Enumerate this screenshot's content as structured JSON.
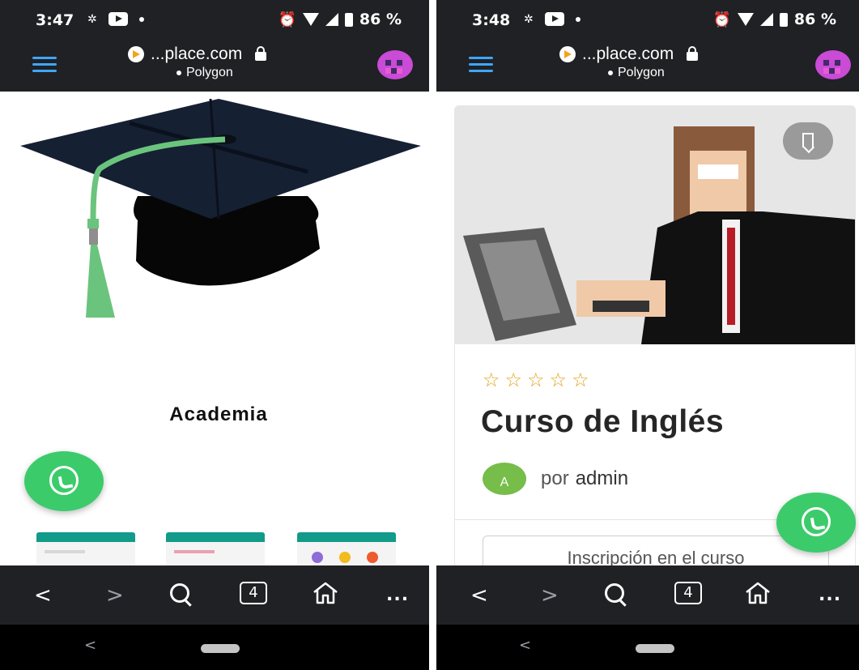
{
  "left": {
    "status": {
      "time": "3:47",
      "battery": "86 %"
    },
    "address": {
      "host": "...place.com",
      "network": "Polygon"
    },
    "page": {
      "title": "Academia"
    },
    "toolbar": {
      "back": "<",
      "forward": ">",
      "tab_count": "4",
      "more": "..."
    },
    "system": {
      "back": "<"
    }
  },
  "right": {
    "status": {
      "time": "3:48",
      "battery": "86 %"
    },
    "address": {
      "host": "...place.com",
      "network": "Polygon"
    },
    "course": {
      "rating_stars": 5,
      "title": "Curso de Inglés",
      "author_prefix": "por",
      "author_name": "admin",
      "author_initial": "A",
      "enroll_label": "Inscripción en el curso"
    },
    "toolbar": {
      "back": "<",
      "forward": ">",
      "tab_count": "4",
      "more": "..."
    },
    "system": {
      "back": "<"
    }
  },
  "colors": {
    "chrome_bg": "#202124",
    "menu_accent": "#3ea6ff",
    "whatsapp": "#3ccb6b",
    "star": "#e3a21a",
    "author_avatar": "#76bd4a"
  },
  "icons": [
    "menu-icon",
    "brave-icon",
    "lock-icon",
    "avatar-icon",
    "search-icon",
    "home-icon",
    "whatsapp-icon",
    "bookmark-icon",
    "star-icon"
  ]
}
